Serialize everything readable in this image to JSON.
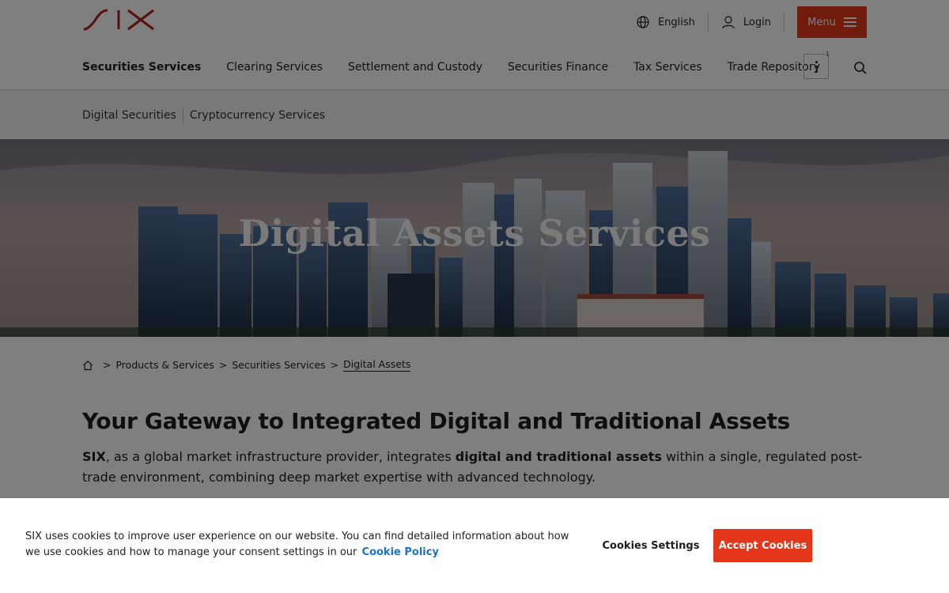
{
  "brand": {
    "logo_text": "SIX",
    "accent": "#e3361b"
  },
  "header": {
    "language": "English",
    "login": "Login",
    "menu": "Menu",
    "more_count": "1"
  },
  "main_nav": [
    {
      "label": "Securities Services",
      "active": true
    },
    {
      "label": "Clearing Services"
    },
    {
      "label": "Settlement and Custody"
    },
    {
      "label": "Securities Finance"
    },
    {
      "label": "Tax Services"
    },
    {
      "label": "Trade Repository"
    }
  ],
  "sub_nav": [
    {
      "label": "Digital Securities"
    },
    {
      "label": "Cryptocurrency Services"
    }
  ],
  "hero": {
    "title": "Digital Assets Services"
  },
  "breadcrumb": {
    "items": [
      "Products & Services",
      "Securities Services",
      "Digital Assets"
    ],
    "separator": ">"
  },
  "content": {
    "headline": "Your Gateway to Integrated Digital and Traditional Assets",
    "intro_1": "SIX",
    "intro_2": ", as a global market infrastructure provider, integrates ",
    "intro_3": "digital and traditional assets",
    "intro_4": " within a single, regulated post-trade environment, combining deep market expertise with advanced technology."
  },
  "cookie": {
    "text": "SIX uses cookies to improve user experience on our website. You can find detailed information about how we use cookies and how to manage your consent settings in our",
    "policy_link": "Cookie Policy",
    "settings_button": "Cookies Settings",
    "accept_button": "Accept Cookies"
  }
}
